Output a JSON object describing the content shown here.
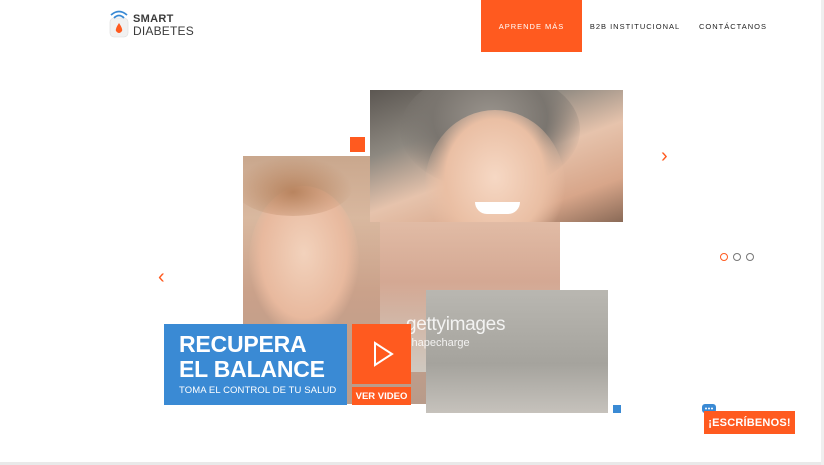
{
  "brand": {
    "line1": "SMART",
    "line2": "DIABETES",
    "icon": "wifi-drop-logo-icon"
  },
  "nav": [
    {
      "label": "APRENDE MÁS",
      "active": true
    },
    {
      "label": "B2B INSTITUCIONAL",
      "active": false
    },
    {
      "label": "CONTÁCTANOS",
      "active": false
    }
  ],
  "hero": {
    "title_line1": "RECUPERA",
    "title_line2": "EL BALANCE",
    "subtitle": "TOMA EL CONTROL DE TU SALUD",
    "video_button": "VER VIDEO",
    "watermark_brand": "gettyimages",
    "watermark_author": "shapecharge",
    "slides": {
      "count": 3,
      "active": 1
    }
  },
  "chat": {
    "label": "¡ESCRÍBENOS!",
    "icon": "chat-bubble-icon"
  },
  "colors": {
    "accent": "#ff5a1f",
    "blue": "#3a8ad4",
    "text": "#222222"
  }
}
